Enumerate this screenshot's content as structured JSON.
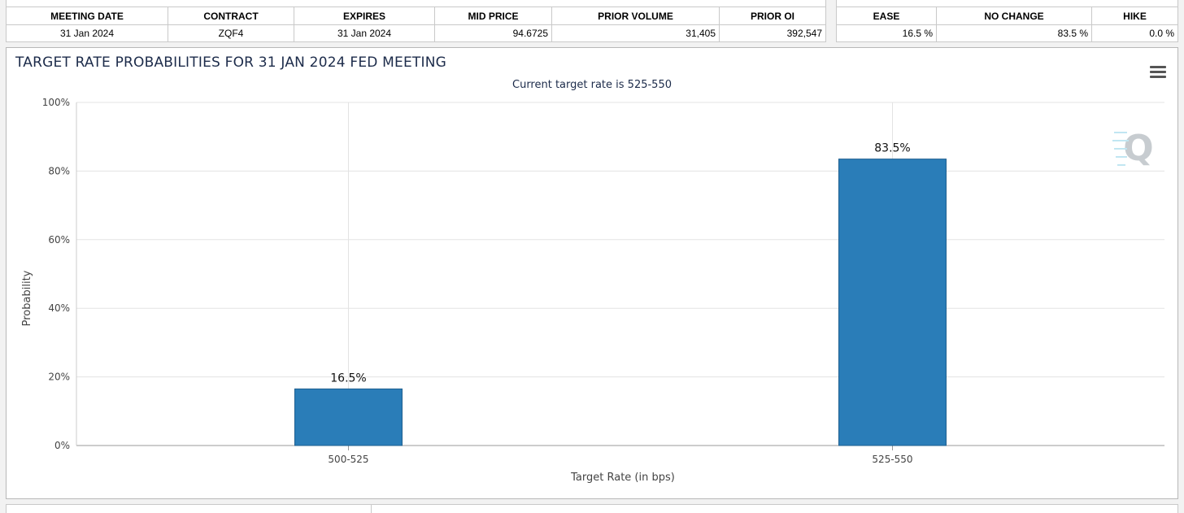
{
  "summary_table": {
    "headers": [
      "MEETING DATE",
      "CONTRACT",
      "EXPIRES",
      "MID PRICE",
      "PRIOR VOLUME",
      "PRIOR OI"
    ],
    "row": [
      "31 Jan 2024",
      "ZQF4",
      "31 Jan 2024",
      "94.6725",
      "31,405",
      "392,547"
    ]
  },
  "probability_table": {
    "headers": [
      "EASE",
      "NO CHANGE",
      "HIKE"
    ],
    "row": [
      "16.5 %",
      "83.5 %",
      "0.0 %"
    ]
  },
  "chart_panel": {
    "menu_icon": "hamburger-menu-icon",
    "watermark_icon": "q-logo-icon"
  },
  "chart_data": {
    "type": "bar",
    "title": "TARGET RATE PROBABILITIES FOR 31 JAN 2024 FED MEETING",
    "subtitle": "Current target rate is 525-550",
    "xlabel": "Target Rate (in bps)",
    "ylabel": "Probability",
    "categories": [
      "500-525",
      "525-550"
    ],
    "values": [
      16.5,
      83.5
    ],
    "data_labels": [
      "16.5%",
      "83.5%"
    ],
    "ylim": [
      0,
      100
    ],
    "yticks": [
      0,
      20,
      40,
      60,
      80,
      100
    ],
    "ytick_labels": [
      "0%",
      "20%",
      "40%",
      "60%",
      "80%",
      "100%"
    ],
    "grid": true,
    "bar_color": "#2a7db8",
    "bar_edge_color": "#1f5f8f"
  }
}
